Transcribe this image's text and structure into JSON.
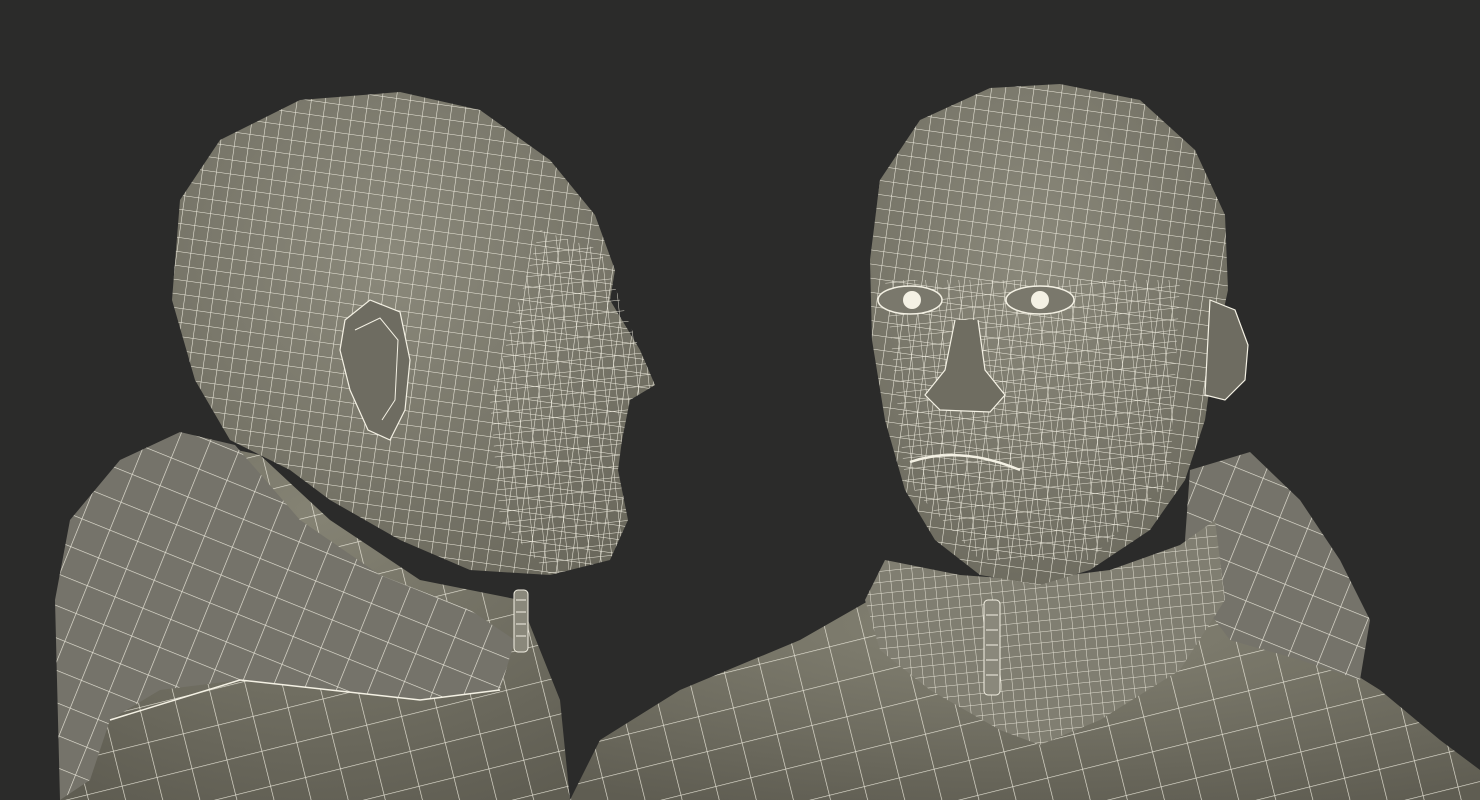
{
  "scene": {
    "background_color": "#2b2b2a",
    "mesh_fill_color": "#7d7b6d",
    "mesh_shade_color": "#5d5b50",
    "wire_color": "#f4f1e4",
    "views": [
      {
        "name": "side-view",
        "subject": "head-and-hooded-jacket-wireframe"
      },
      {
        "name": "front-view",
        "subject": "head-and-hooded-jacket-wireframe"
      }
    ]
  }
}
